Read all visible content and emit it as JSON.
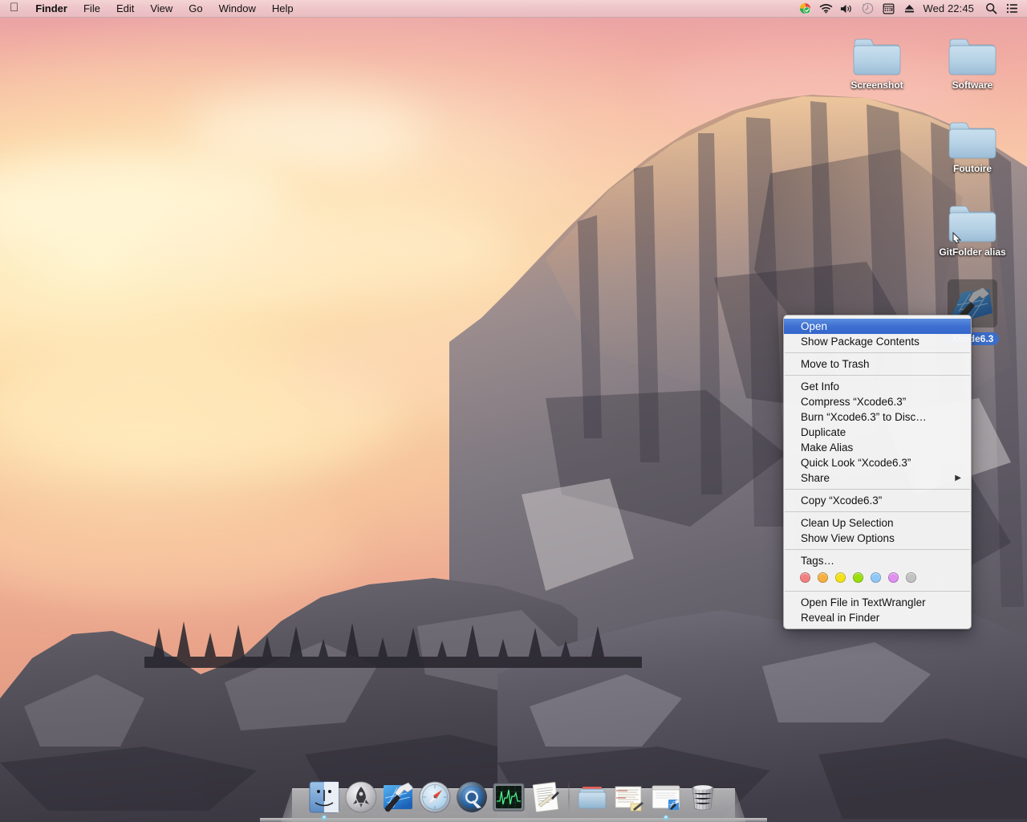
{
  "menubar": {
    "apple_icon": "apple-logo-icon",
    "items": [
      {
        "label": "Finder",
        "bold": true
      },
      {
        "label": "File",
        "bold": false
      },
      {
        "label": "Edit",
        "bold": false
      },
      {
        "label": "View",
        "bold": false
      },
      {
        "label": "Go",
        "bold": false
      },
      {
        "label": "Window",
        "bold": false
      },
      {
        "label": "Help",
        "bold": false
      }
    ],
    "status_icons": [
      "google-drive-icon",
      "wifi-icon",
      "volume-icon",
      "time-machine-icon",
      "input-source-icon",
      "eject-icon"
    ],
    "clock": "Wed 22:45",
    "search_icon": "spotlight-search-icon",
    "notification_icon": "notification-center-icon",
    "bar_color": "#efc9cc"
  },
  "desktop": {
    "wallpaper_name": "yosemite-half-dome",
    "sky_top_color": "#e8a0a6",
    "sky_mid_color": "#fbd9ae",
    "rock_color": "#6e6a70",
    "icons": [
      {
        "label": "Screenshot",
        "type": "folder",
        "selected": false,
        "alias": false
      },
      {
        "label": "Software",
        "type": "folder",
        "selected": false,
        "alias": false
      },
      {
        "label": "Foutoire",
        "type": "folder",
        "selected": false,
        "alias": false
      },
      {
        "label": "GitFolder alias",
        "type": "folder",
        "selected": false,
        "alias": true
      },
      {
        "label": "Xcode6.3",
        "type": "application",
        "selected": true,
        "alias": false
      }
    ],
    "folder_color": "#a8c6dd",
    "selection_color": "#3b6ecc"
  },
  "context_menu": {
    "target_name": "Xcode6.3",
    "highlight_color": "#3e6fd0",
    "groups": [
      {
        "items": [
          {
            "label": "Open",
            "highlighted": true,
            "submenu": false
          },
          {
            "label": "Show Package Contents",
            "highlighted": false,
            "submenu": false
          }
        ]
      },
      {
        "items": [
          {
            "label": "Move to Trash",
            "highlighted": false,
            "submenu": false
          }
        ]
      },
      {
        "items": [
          {
            "label": "Get Info",
            "highlighted": false,
            "submenu": false
          },
          {
            "label": "Compress “Xcode6.3”",
            "highlighted": false,
            "submenu": false
          },
          {
            "label": "Burn “Xcode6.3” to Disc…",
            "highlighted": false,
            "submenu": false
          },
          {
            "label": "Duplicate",
            "highlighted": false,
            "submenu": false
          },
          {
            "label": "Make Alias",
            "highlighted": false,
            "submenu": false
          },
          {
            "label": "Quick Look “Xcode6.3”",
            "highlighted": false,
            "submenu": false
          },
          {
            "label": "Share",
            "highlighted": false,
            "submenu": true
          }
        ]
      },
      {
        "items": [
          {
            "label": "Copy “Xcode6.3”",
            "highlighted": false,
            "submenu": false
          }
        ]
      },
      {
        "items": [
          {
            "label": "Clean Up Selection",
            "highlighted": false,
            "submenu": false
          },
          {
            "label": "Show View Options",
            "highlighted": false,
            "submenu": false
          }
        ]
      },
      {
        "items": [
          {
            "label": "Tags…",
            "highlighted": false,
            "submenu": false
          }
        ],
        "tags": [
          "#f2807f",
          "#f5b041",
          "#f5e216",
          "#9ade0a",
          "#8fc8f5",
          "#e08ef0",
          "#c2c2c2"
        ]
      },
      {
        "items": [
          {
            "label": "Open File in TextWrangler",
            "highlighted": false,
            "submenu": false
          },
          {
            "label": "Reveal in Finder",
            "highlighted": false,
            "submenu": false
          }
        ]
      }
    ],
    "submenu_arrow": "▶"
  },
  "dock": {
    "items": [
      {
        "name": "finder-icon",
        "label": "Finder",
        "running": true
      },
      {
        "name": "launchpad-icon",
        "label": "Launchpad",
        "running": false
      },
      {
        "name": "xcode-icon",
        "label": "Xcode",
        "running": false
      },
      {
        "name": "safari-icon",
        "label": "Safari",
        "running": false
      },
      {
        "name": "quicktime-icon",
        "label": "QuickTime Player",
        "running": false
      },
      {
        "name": "activity-monitor-icon",
        "label": "Activity Monitor",
        "running": false
      },
      {
        "name": "textedit-icon",
        "label": "TextEdit",
        "running": false
      },
      {
        "name": "separator",
        "label": "",
        "running": false
      },
      {
        "name": "downloads-folder-icon",
        "label": "Downloads",
        "running": false
      },
      {
        "name": "document-stack-icon",
        "label": "Documents",
        "running": false
      },
      {
        "name": "document-window-icon",
        "label": "Document",
        "running": true
      },
      {
        "name": "trash-icon",
        "label": "Trash",
        "running": false
      }
    ],
    "shelf_color": "#c4c4c4"
  }
}
